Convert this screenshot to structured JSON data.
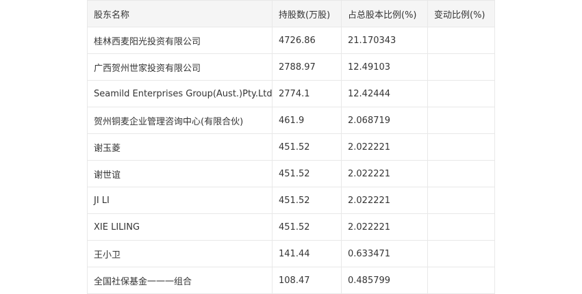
{
  "table": {
    "headers": [
      "股东名称",
      "持股数(万股)",
      "占总股本比例(%)",
      "变动比例(%)"
    ],
    "rows": [
      [
        "桂林西麦阳光投资有限公司",
        "4726.86",
        "21.170343",
        ""
      ],
      [
        "广西贺州世家投资有限公司",
        "2788.97",
        "12.49103",
        ""
      ],
      [
        "Seamild Enterprises Group(Aust.)Pty.Ltd",
        "2774.1",
        "12.42444",
        ""
      ],
      [
        "贺州铜麦企业管理咨询中心(有限合伙)",
        "461.9",
        "2.068719",
        ""
      ],
      [
        "谢玉菱",
        "451.52",
        "2.022221",
        ""
      ],
      [
        "谢世谊",
        "451.52",
        "2.022221",
        ""
      ],
      [
        "JI LI",
        "451.52",
        "2.022221",
        ""
      ],
      [
        "XIE LILING",
        "451.52",
        "2.022221",
        ""
      ],
      [
        "王小卫",
        "141.44",
        "0.633471",
        ""
      ],
      [
        "全国社保基金一一一组合",
        "108.47",
        "0.485799",
        ""
      ]
    ]
  }
}
